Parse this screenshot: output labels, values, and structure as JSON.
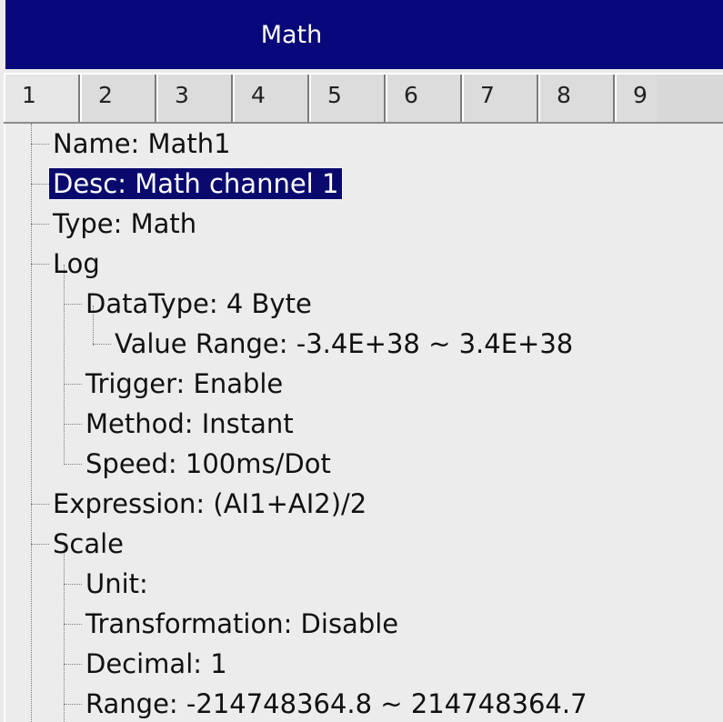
{
  "window": {
    "title": "Math"
  },
  "tabs": [
    "1",
    "2",
    "3",
    "4",
    "5",
    "6",
    "7",
    "8",
    "9"
  ],
  "tree": {
    "name": "Name: Math1",
    "desc": "Desc: Math channel 1",
    "type": "Type: Math",
    "log": "Log",
    "datatype": "DataType: 4 Byte",
    "value_range": "Value Range: -3.4E+38  ~ 3.4E+38",
    "trigger": "Trigger: Enable",
    "method": "Method: Instant",
    "speed": "Speed: 100ms/Dot",
    "expression": "Expression: (AI1+AI2)/2",
    "scale": "Scale",
    "unit": "Unit:",
    "transformation": "Transformation: Disable",
    "decimal": "Decimal: 1",
    "range": "Range: -214748364.8 ~ 214748364.7"
  },
  "colors": {
    "titlebar": "#08087a",
    "selection": "#0a0a6e",
    "background": "#ececec"
  }
}
